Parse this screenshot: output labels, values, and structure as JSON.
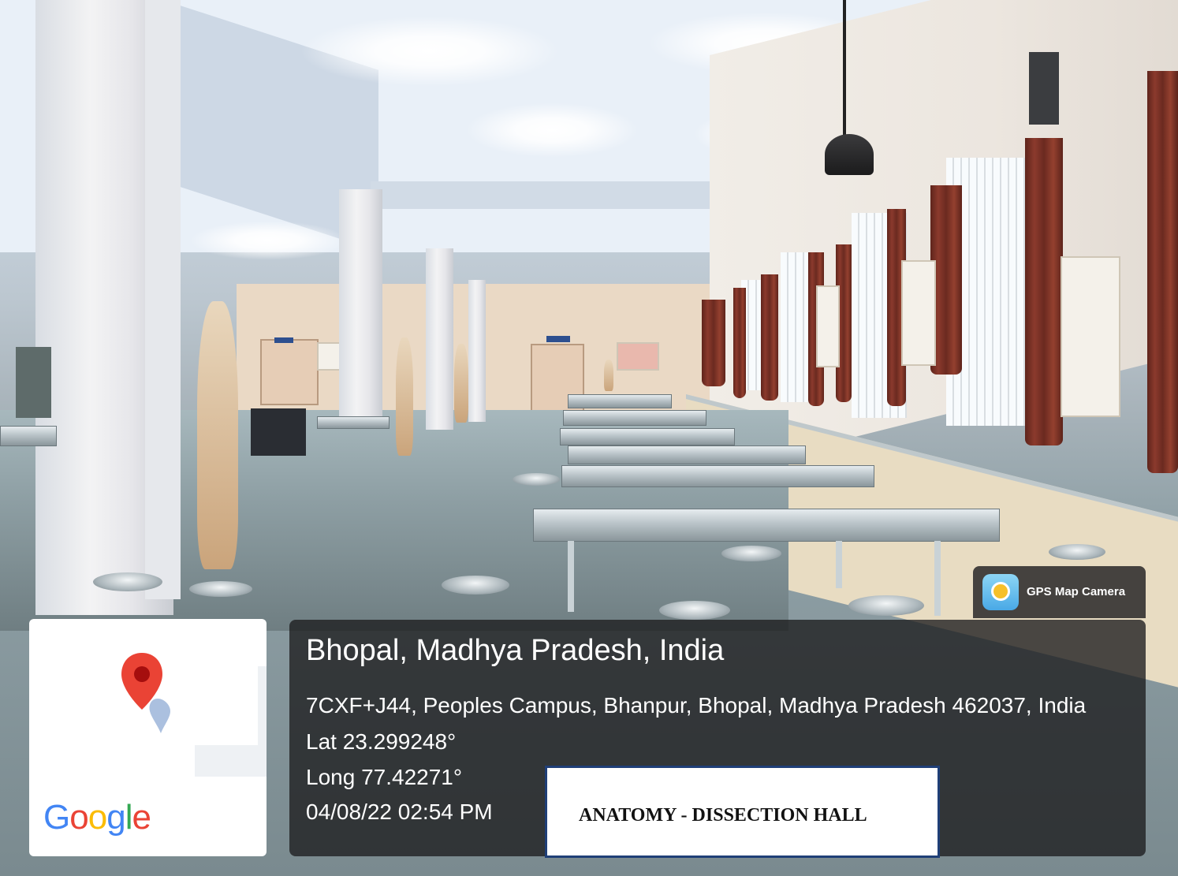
{
  "photo": {
    "scene_icon": "dissection-hall-photo"
  },
  "map_thumbnail": {
    "pin_icon": "map-pin-icon",
    "pin_color": "#ea4335",
    "logo_text": [
      "G",
      "o",
      "o",
      "g",
      "l",
      "e"
    ]
  },
  "app_badge": {
    "label": "GPS Map Camera",
    "icon": "gps-map-camera-icon"
  },
  "location": {
    "title": "Bhopal, Madhya Pradesh, India",
    "address": "7CXF+J44, Peoples Campus, Bhanpur, Bhopal, Madhya Pradesh 462037, India",
    "latitude": "Lat 23.299248°",
    "longitude": "Long 77.42271°",
    "datetime": "04/08/22 02:54 PM"
  },
  "caption": {
    "text": "ANATOMY - DISSECTION HALL",
    "border_color": "#1f3f77"
  }
}
